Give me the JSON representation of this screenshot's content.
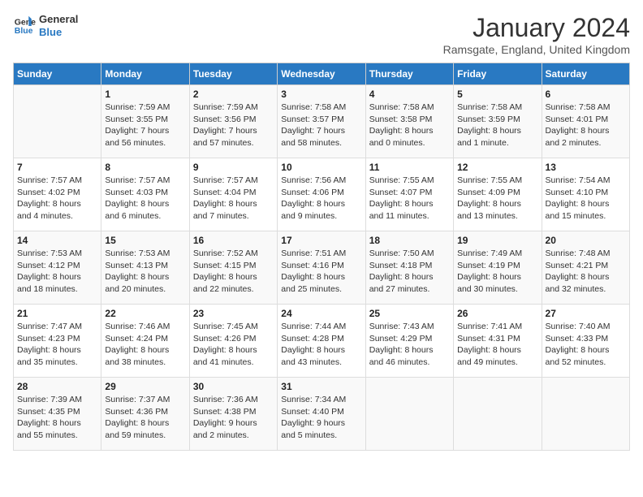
{
  "logo": {
    "line1": "General",
    "line2": "Blue"
  },
  "title": "January 2024",
  "subtitle": "Ramsgate, England, United Kingdom",
  "days_header": [
    "Sunday",
    "Monday",
    "Tuesday",
    "Wednesday",
    "Thursday",
    "Friday",
    "Saturday"
  ],
  "weeks": [
    [
      {
        "num": "",
        "detail": ""
      },
      {
        "num": "1",
        "detail": "Sunrise: 7:59 AM\nSunset: 3:55 PM\nDaylight: 7 hours\nand 56 minutes."
      },
      {
        "num": "2",
        "detail": "Sunrise: 7:59 AM\nSunset: 3:56 PM\nDaylight: 7 hours\nand 57 minutes."
      },
      {
        "num": "3",
        "detail": "Sunrise: 7:58 AM\nSunset: 3:57 PM\nDaylight: 7 hours\nand 58 minutes."
      },
      {
        "num": "4",
        "detail": "Sunrise: 7:58 AM\nSunset: 3:58 PM\nDaylight: 8 hours\nand 0 minutes."
      },
      {
        "num": "5",
        "detail": "Sunrise: 7:58 AM\nSunset: 3:59 PM\nDaylight: 8 hours\nand 1 minute."
      },
      {
        "num": "6",
        "detail": "Sunrise: 7:58 AM\nSunset: 4:01 PM\nDaylight: 8 hours\nand 2 minutes."
      }
    ],
    [
      {
        "num": "7",
        "detail": "Sunrise: 7:57 AM\nSunset: 4:02 PM\nDaylight: 8 hours\nand 4 minutes."
      },
      {
        "num": "8",
        "detail": "Sunrise: 7:57 AM\nSunset: 4:03 PM\nDaylight: 8 hours\nand 6 minutes."
      },
      {
        "num": "9",
        "detail": "Sunrise: 7:57 AM\nSunset: 4:04 PM\nDaylight: 8 hours\nand 7 minutes."
      },
      {
        "num": "10",
        "detail": "Sunrise: 7:56 AM\nSunset: 4:06 PM\nDaylight: 8 hours\nand 9 minutes."
      },
      {
        "num": "11",
        "detail": "Sunrise: 7:55 AM\nSunset: 4:07 PM\nDaylight: 8 hours\nand 11 minutes."
      },
      {
        "num": "12",
        "detail": "Sunrise: 7:55 AM\nSunset: 4:09 PM\nDaylight: 8 hours\nand 13 minutes."
      },
      {
        "num": "13",
        "detail": "Sunrise: 7:54 AM\nSunset: 4:10 PM\nDaylight: 8 hours\nand 15 minutes."
      }
    ],
    [
      {
        "num": "14",
        "detail": "Sunrise: 7:53 AM\nSunset: 4:12 PM\nDaylight: 8 hours\nand 18 minutes."
      },
      {
        "num": "15",
        "detail": "Sunrise: 7:53 AM\nSunset: 4:13 PM\nDaylight: 8 hours\nand 20 minutes."
      },
      {
        "num": "16",
        "detail": "Sunrise: 7:52 AM\nSunset: 4:15 PM\nDaylight: 8 hours\nand 22 minutes."
      },
      {
        "num": "17",
        "detail": "Sunrise: 7:51 AM\nSunset: 4:16 PM\nDaylight: 8 hours\nand 25 minutes."
      },
      {
        "num": "18",
        "detail": "Sunrise: 7:50 AM\nSunset: 4:18 PM\nDaylight: 8 hours\nand 27 minutes."
      },
      {
        "num": "19",
        "detail": "Sunrise: 7:49 AM\nSunset: 4:19 PM\nDaylight: 8 hours\nand 30 minutes."
      },
      {
        "num": "20",
        "detail": "Sunrise: 7:48 AM\nSunset: 4:21 PM\nDaylight: 8 hours\nand 32 minutes."
      }
    ],
    [
      {
        "num": "21",
        "detail": "Sunrise: 7:47 AM\nSunset: 4:23 PM\nDaylight: 8 hours\nand 35 minutes."
      },
      {
        "num": "22",
        "detail": "Sunrise: 7:46 AM\nSunset: 4:24 PM\nDaylight: 8 hours\nand 38 minutes."
      },
      {
        "num": "23",
        "detail": "Sunrise: 7:45 AM\nSunset: 4:26 PM\nDaylight: 8 hours\nand 41 minutes."
      },
      {
        "num": "24",
        "detail": "Sunrise: 7:44 AM\nSunset: 4:28 PM\nDaylight: 8 hours\nand 43 minutes."
      },
      {
        "num": "25",
        "detail": "Sunrise: 7:43 AM\nSunset: 4:29 PM\nDaylight: 8 hours\nand 46 minutes."
      },
      {
        "num": "26",
        "detail": "Sunrise: 7:41 AM\nSunset: 4:31 PM\nDaylight: 8 hours\nand 49 minutes."
      },
      {
        "num": "27",
        "detail": "Sunrise: 7:40 AM\nSunset: 4:33 PM\nDaylight: 8 hours\nand 52 minutes."
      }
    ],
    [
      {
        "num": "28",
        "detail": "Sunrise: 7:39 AM\nSunset: 4:35 PM\nDaylight: 8 hours\nand 55 minutes."
      },
      {
        "num": "29",
        "detail": "Sunrise: 7:37 AM\nSunset: 4:36 PM\nDaylight: 8 hours\nand 59 minutes."
      },
      {
        "num": "30",
        "detail": "Sunrise: 7:36 AM\nSunset: 4:38 PM\nDaylight: 9 hours\nand 2 minutes."
      },
      {
        "num": "31",
        "detail": "Sunrise: 7:34 AM\nSunset: 4:40 PM\nDaylight: 9 hours\nand 5 minutes."
      },
      {
        "num": "",
        "detail": ""
      },
      {
        "num": "",
        "detail": ""
      },
      {
        "num": "",
        "detail": ""
      }
    ]
  ]
}
